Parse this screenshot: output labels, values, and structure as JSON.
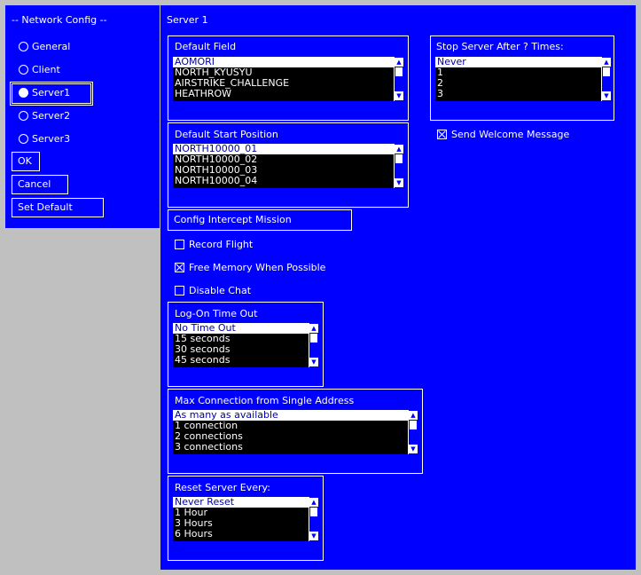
{
  "sidebar": {
    "title": "-- Network Config --",
    "items": [
      {
        "label": "General",
        "selected": false
      },
      {
        "label": "Client",
        "selected": false
      },
      {
        "label": "Server1",
        "selected": true
      },
      {
        "label": "Server2",
        "selected": false
      },
      {
        "label": "Server3",
        "selected": false
      }
    ],
    "ok_label": "OK",
    "cancel_label": "Cancel",
    "set_default_label": "Set Default"
  },
  "main": {
    "title": "Server 1",
    "default_field": {
      "title": "Default Field",
      "items": [
        "AOMORI",
        "NORTH_KYUSYU",
        "AIRSTRIKE_CHALLENGE",
        "HEATHROW"
      ],
      "selected_index": 0
    },
    "stop_server": {
      "title": "Stop Server After ? Times:",
      "items": [
        "Never",
        "1",
        "2",
        "3"
      ],
      "selected_index": 0
    },
    "send_welcome": {
      "label": "Send Welcome Message",
      "checked": true
    },
    "default_start": {
      "title": "Default Start Position",
      "items": [
        "NORTH10000_01",
        "NORTH10000_02",
        "NORTH10000_03",
        "NORTH10000_04"
      ],
      "selected_index": 0
    },
    "config_intercept_label": "Config Intercept Mission",
    "record_flight": {
      "label": "Record Flight",
      "checked": false
    },
    "free_memory": {
      "label": "Free Memory When Possible",
      "checked": true
    },
    "disable_chat": {
      "label": "Disable Chat",
      "checked": false
    },
    "logon_timeout": {
      "title": "Log-On Time Out",
      "items": [
        "No Time Out",
        "15 seconds",
        "30 seconds",
        "45 seconds"
      ],
      "selected_index": 0
    },
    "max_connection": {
      "title": "Max Connection from Single Address",
      "items": [
        "As many as available",
        "1 connection",
        "2 connections",
        "3 connections"
      ],
      "selected_index": 0
    },
    "reset_server": {
      "title": "Reset Server Every:",
      "items": [
        "Never Reset",
        "1 Hour",
        "3 Hours",
        "6 Hours"
      ],
      "selected_index": 0
    }
  },
  "icons": {
    "scroll_up": "up-arrow-icon",
    "scroll_down": "down-arrow-icon"
  },
  "colors": {
    "panel": "#0000ff",
    "background": "#c0c0c0",
    "list": "#000000",
    "selected_text": "#0000a0"
  }
}
